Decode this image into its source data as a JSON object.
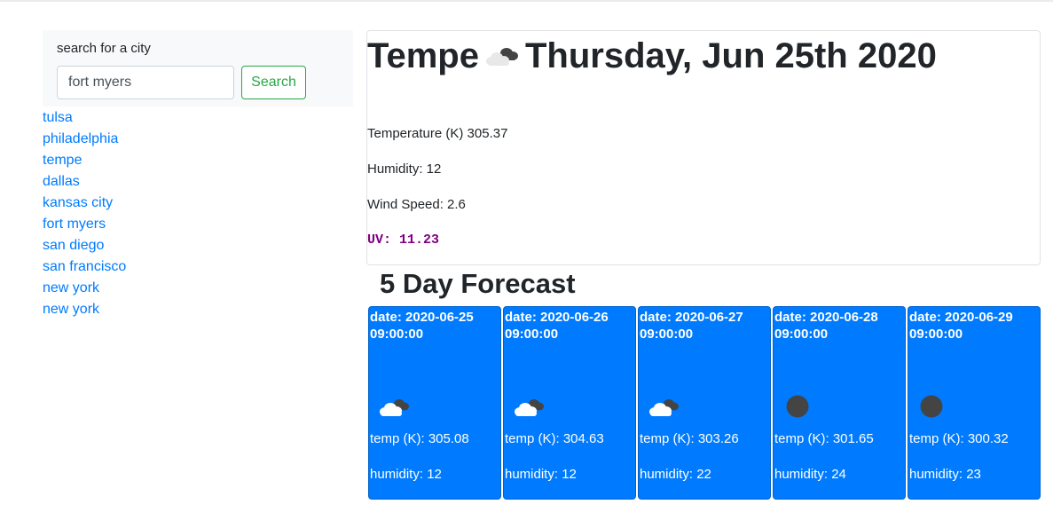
{
  "search": {
    "label": "search for a city",
    "input_value": "fort myers",
    "button_label": "Search"
  },
  "history": [
    "tulsa",
    "philadelphia",
    "tempe",
    "dallas",
    "kansas city",
    "fort myers",
    "san diego",
    "san francisco",
    "new york",
    "new york"
  ],
  "current": {
    "city": "Tempe",
    "date": "Thursday, Jun 25th 2020",
    "icon": "broken-clouds-icon",
    "temperature": "Temperature (K) 305.37",
    "humidity": "Humidity: 12",
    "wind": "Wind Speed: 2.6",
    "uv": "UV: 11.23",
    "uv_color": "#800080"
  },
  "forecast": {
    "title": "5 Day Forecast",
    "days": [
      {
        "date": "date: 2020-06-25 09:00:00",
        "icon": "broken-clouds-icon",
        "temp": "temp (K): 305.08",
        "humidity": "humidity: 12"
      },
      {
        "date": "date: 2020-06-26 09:00:00",
        "icon": "broken-clouds-icon",
        "temp": "temp (K): 304.63",
        "humidity": "humidity: 12"
      },
      {
        "date": "date: 2020-06-27 09:00:00",
        "icon": "broken-clouds-icon",
        "temp": "temp (K): 303.26",
        "humidity": "humidity: 22"
      },
      {
        "date": "date: 2020-06-28 09:00:00",
        "icon": "clear-night-icon",
        "temp": "temp (K): 301.65",
        "humidity": "humidity: 24"
      },
      {
        "date": "date: 2020-06-29 09:00:00",
        "icon": "clear-night-icon",
        "temp": "temp (K): 300.32",
        "humidity": "humidity: 23"
      }
    ]
  },
  "colors": {
    "link": "#007bff",
    "card": "#007bff",
    "search_button": "#28a745"
  }
}
